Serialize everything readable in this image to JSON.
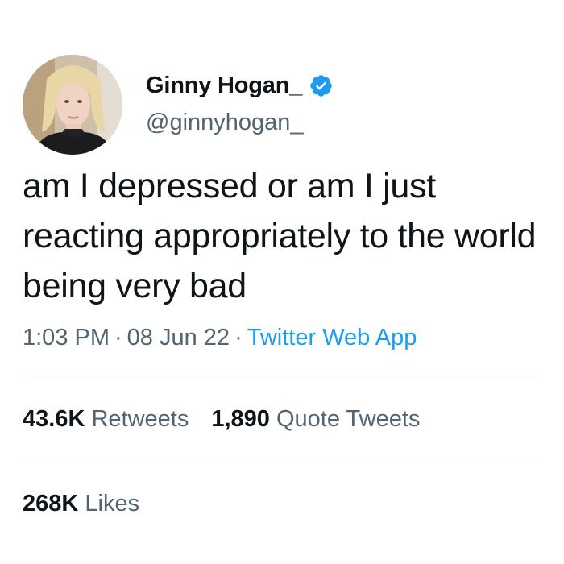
{
  "author": {
    "display_name": "Ginny Hogan_",
    "handle": "@ginnyhogan_",
    "verified": true,
    "verified_icon": "verified-badge-icon",
    "verified_color": "#1d9bf0"
  },
  "tweet": {
    "text": "am I depressed or am I just reacting appropriately to the world being very bad",
    "time": "1:03 PM",
    "date": "08 Jun 22",
    "separator": "·",
    "source": "Twitter Web App"
  },
  "stats": {
    "retweets_count": "43.6K",
    "retweets_label": "Retweets",
    "quotes_count": "1,890",
    "quotes_label": "Quote Tweets",
    "likes_count": "268K",
    "likes_label": "Likes"
  },
  "colors": {
    "text_primary": "#0f1419",
    "text_secondary": "#536471",
    "link": "#1d9bf0",
    "divider": "#eff3f4"
  }
}
